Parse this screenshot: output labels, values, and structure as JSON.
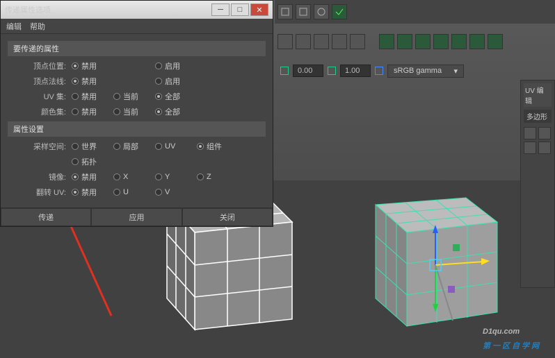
{
  "dialog": {
    "title": "传递属性选项",
    "menu": {
      "edit": "编辑",
      "help": "帮助"
    },
    "section1": "要传递的属性",
    "section2": "属性设置",
    "rows": {
      "vertPos": {
        "label": "顶点位置:",
        "opts": [
          "禁用",
          "启用"
        ]
      },
      "vertNorm": {
        "label": "顶点法线:",
        "opts": [
          "禁用",
          "启用"
        ]
      },
      "uvSet": {
        "label": "UV 集:",
        "opts": [
          "禁用",
          "当前",
          "全部"
        ]
      },
      "colorSet": {
        "label": "颜色集:",
        "opts": [
          "禁用",
          "当前",
          "全部"
        ]
      },
      "sampleSpace": {
        "label": "采样空间:",
        "opts": [
          "世界",
          "局部",
          "UV",
          "组件"
        ],
        "opts2": [
          "拓扑"
        ]
      },
      "mirror": {
        "label": "镜像:",
        "opts": [
          "禁用",
          "X",
          "Y",
          "Z"
        ]
      },
      "flipUV": {
        "label": "翻转 UV:",
        "opts": [
          "禁用",
          "U",
          "V"
        ]
      }
    },
    "btns": {
      "transfer": "传递",
      "apply": "应用",
      "close": "关闭"
    }
  },
  "display": {
    "val1": "0.00",
    "val2": "1.00",
    "gamma": "sRGB gamma"
  },
  "uvPanel": {
    "title": "UV 编辑",
    "tab": "多边形"
  },
  "watermark": {
    "main": "D1qu.com",
    "sub": "第一区自学网"
  }
}
